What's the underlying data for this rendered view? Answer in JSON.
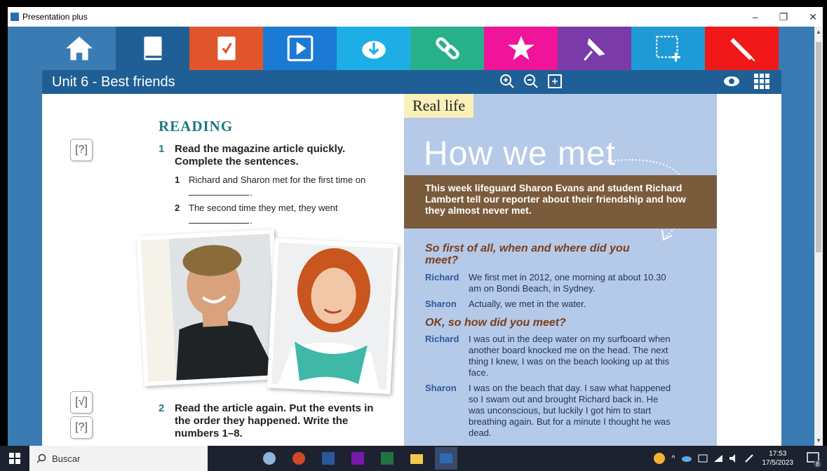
{
  "window": {
    "title": "Presentation plus",
    "min": "–",
    "restore": "❐",
    "close": "✕"
  },
  "toolbar": {
    "tools": [
      {
        "name": "home",
        "color": "#3a7bb3"
      },
      {
        "name": "book",
        "color": "#1f5f95"
      },
      {
        "name": "workbook",
        "color": "#e0552b"
      },
      {
        "name": "video",
        "color": "#1a7ad4"
      },
      {
        "name": "download",
        "color": "#1eaee6"
      },
      {
        "name": "link",
        "color": "#27b08a"
      },
      {
        "name": "star",
        "color": "#f0149a"
      },
      {
        "name": "pin",
        "color": "#7a3aa8"
      },
      {
        "name": "select",
        "color": "#1e9bd6"
      },
      {
        "name": "pencil",
        "color": "#f01818"
      }
    ]
  },
  "unitbar": {
    "title": "Unit 6 - Best friends"
  },
  "left_page": {
    "heading": "READING",
    "ex1_num": "1",
    "ex1_text_1": "Read the magazine article quickly.",
    "ex1_text_2": "Complete the sentences.",
    "item1_num": "1",
    "item1_text": "Richard and Sharon met for the first time on",
    "item2_num": "2",
    "item2_text": "The second time they met, they went",
    "blank_dot": ".",
    "icon_q": "[?]",
    "icon_check": "[√]",
    "ex2_num": "2",
    "ex2_text_1": "Read the article again. Put the events in",
    "ex2_text_2": "the order they happened. Write the",
    "ex2_text_3": "numbers 1–8."
  },
  "right_page": {
    "tag": "Real life",
    "title": "How we met",
    "banner": "This week lifeguard Sharon Evans and student Richard Lambert tell our reporter about their friendship and how they almost never met.",
    "q1": "So first of all, when and where did you meet?",
    "a1_speaker": "Richard",
    "a1_text": "We first met in 2012, one morning at about 10.30 am on Bondi Beach, in Sydney.",
    "a2_speaker": "Sharon",
    "a2_text": "Actually, we met in the water.",
    "q2": "OK, so how did you meet?",
    "a3_speaker": "Richard",
    "a3_text": "I was out in the deep water on my surfboard when another board knocked me on the head. The next thing I knew, I was on the beach looking up at this face.",
    "a4_speaker": "Sharon",
    "a4_text": "I was on the beach that day. I saw what happened so I swam out and brought Richard back in. He was unconscious, but luckily I got him to start breathing again. But for a minute I thought he was dead."
  },
  "taskbar": {
    "search_placeholder": "Buscar",
    "time": "17:53",
    "date": "17/5/2023",
    "notifications": "8"
  }
}
